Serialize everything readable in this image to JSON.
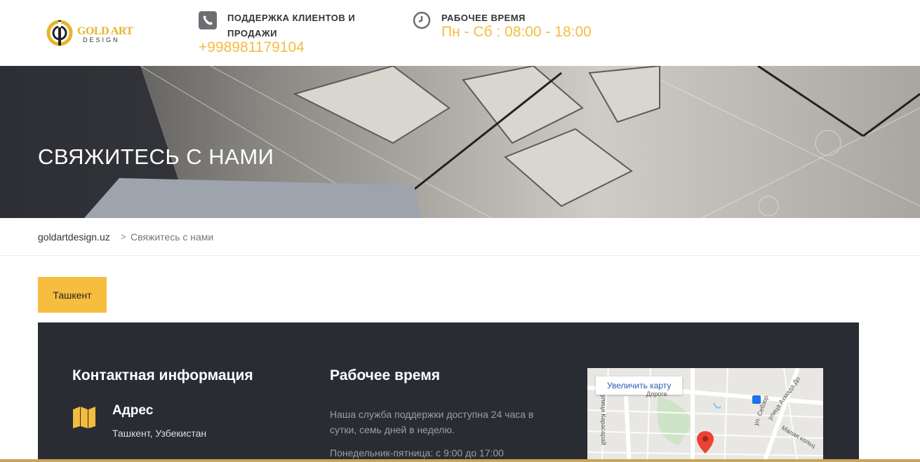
{
  "header": {
    "logo": {
      "brand": "GOLD ART",
      "sub": "DESIGN"
    },
    "support": {
      "title_line1": "ПОДДЕРЖКА КЛИЕНТОВ И",
      "title_line2": "ПРОДАЖИ",
      "phone": "+998981179104",
      "icon": "phone-icon"
    },
    "hours": {
      "title": "РАБОЧЕЕ ВРЕМЯ",
      "value": "Пн - Сб : 08:00 - 18:00",
      "icon": "clock-icon"
    }
  },
  "banner": {
    "title": "СВЯЖИТЕСЬ С НАМИ"
  },
  "breadcrumb": {
    "home": "goldartdesign.uz",
    "separator": ">",
    "current": "Свяжитесь с нами"
  },
  "tabs": {
    "active": "Ташкент"
  },
  "contact": {
    "heading": "Контактная информация",
    "address_title": "Адрес",
    "address_value": "Ташкент, Узбекистан",
    "address_icon": "map-icon"
  },
  "working": {
    "heading": "Рабочее время",
    "line1": "Наша служба поддержки доступна 24 часа в сутки, семь дней в неделю.",
    "line2": "Понедельник-пятница: с 9:00 до 17:00"
  },
  "map": {
    "enlarge_button": "Увеличить карту",
    "streets": [
      "улица Карасарай",
      "ул. Себзор",
      "улица Ахмада До",
      "Малая кольц",
      "Дорога"
    ]
  },
  "colors": {
    "accent": "#f3bc3f",
    "panel": "#292c33"
  }
}
